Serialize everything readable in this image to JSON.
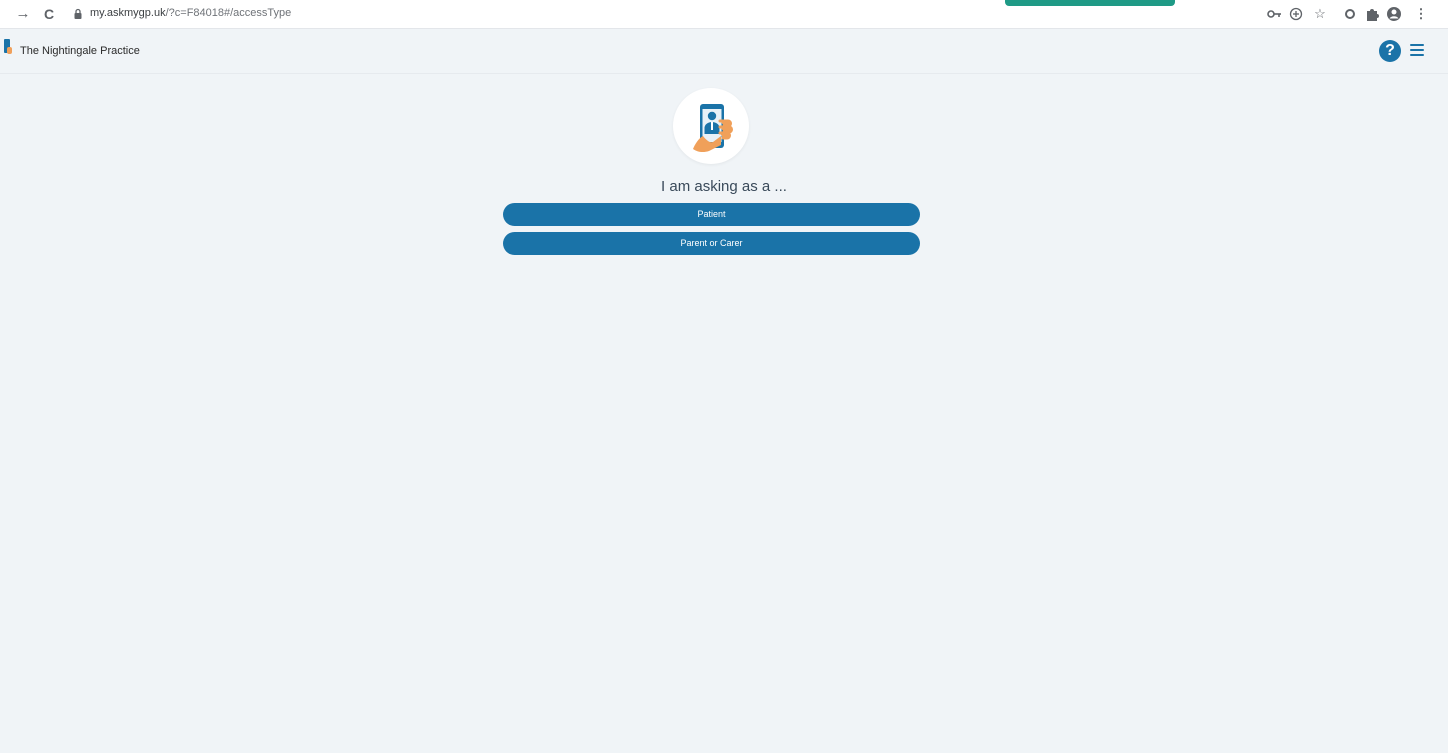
{
  "browser": {
    "url_host": "my.askmygp.uk",
    "url_path": "/?c=F84018#/accessType"
  },
  "header": {
    "practice_name": "The Nightingale Practice",
    "help_label": "?"
  },
  "main": {
    "prompt": "I am asking as a ...",
    "options": [
      {
        "label": "Patient"
      },
      {
        "label": "Parent or Carer"
      }
    ]
  },
  "colors": {
    "accent": "#1a73a8",
    "background": "#f0f4f7",
    "hand": "#f0a05a"
  },
  "icons": {
    "back": "arrow-right-icon",
    "reload": "reload-icon",
    "lock": "lock-icon",
    "key": "key-icon",
    "zoom": "zoom-icon",
    "bookmark": "star-icon",
    "extension_circle": "circle-extension-icon",
    "extensions": "puzzle-icon",
    "profile": "profile-icon",
    "more": "more-vert-icon",
    "help": "help-icon",
    "menu": "hamburger-menu-icon",
    "hero": "phone-in-hand-icon"
  }
}
